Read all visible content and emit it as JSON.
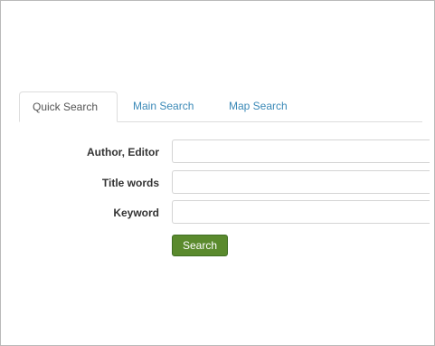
{
  "tabs": [
    {
      "label": "Quick Search",
      "active": true
    },
    {
      "label": "Main Search",
      "active": false
    },
    {
      "label": "Map Search",
      "active": false
    }
  ],
  "form": {
    "fields": [
      {
        "label": "Author, Editor",
        "value": "",
        "placeholder": ""
      },
      {
        "label": "Title words",
        "value": "",
        "placeholder": ""
      },
      {
        "label": "Keyword",
        "value": "",
        "placeholder": ""
      }
    ],
    "submit_label": "Search"
  },
  "colors": {
    "link": "#3a89b7",
    "button_bg": "#5a8a2d",
    "border": "#dddddd"
  }
}
